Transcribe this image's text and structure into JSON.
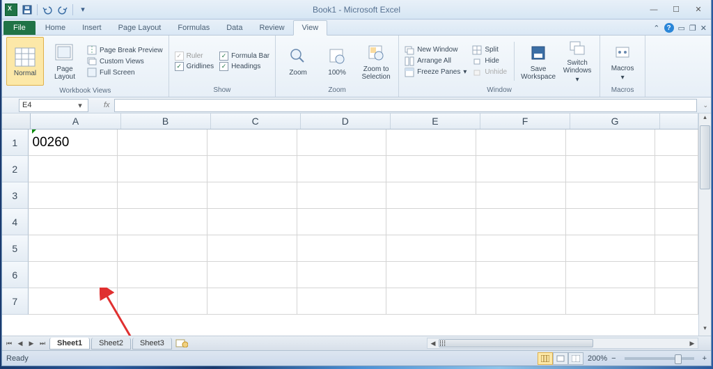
{
  "window": {
    "title": "Book1 - Microsoft Excel"
  },
  "tabs": {
    "file": "File",
    "items": [
      "Home",
      "Insert",
      "Page Layout",
      "Formulas",
      "Data",
      "Review",
      "View"
    ],
    "active": "View"
  },
  "ribbon": {
    "workbook_views": {
      "label": "Workbook Views",
      "normal": "Normal",
      "page_layout": "Page\nLayout",
      "page_break": "Page Break Preview",
      "custom": "Custom Views",
      "full": "Full Screen"
    },
    "show": {
      "label": "Show",
      "ruler": "Ruler",
      "formula_bar": "Formula Bar",
      "gridlines": "Gridlines",
      "headings": "Headings"
    },
    "zoom": {
      "label": "Zoom",
      "zoom": "Zoom",
      "hundred": "100%",
      "selection": "Zoom to\nSelection"
    },
    "window": {
      "label": "Window",
      "new_win": "New Window",
      "arrange": "Arrange All",
      "freeze": "Freeze Panes",
      "split": "Split",
      "hide": "Hide",
      "unhide": "Unhide",
      "save_ws": "Save\nWorkspace",
      "switch": "Switch\nWindows"
    },
    "macros": {
      "label": "Macros",
      "macros": "Macros"
    }
  },
  "formula_bar": {
    "name_box": "E4",
    "fx": "fx"
  },
  "grid": {
    "columns": [
      "A",
      "B",
      "C",
      "D",
      "E",
      "F",
      "G"
    ],
    "rows": [
      "1",
      "2",
      "3",
      "4",
      "5",
      "6",
      "7"
    ],
    "cell_a1": "00260"
  },
  "sheets": {
    "items": [
      "Sheet1",
      "Sheet2",
      "Sheet3"
    ],
    "active": "Sheet1"
  },
  "status": {
    "ready": "Ready",
    "zoom": "200%"
  }
}
